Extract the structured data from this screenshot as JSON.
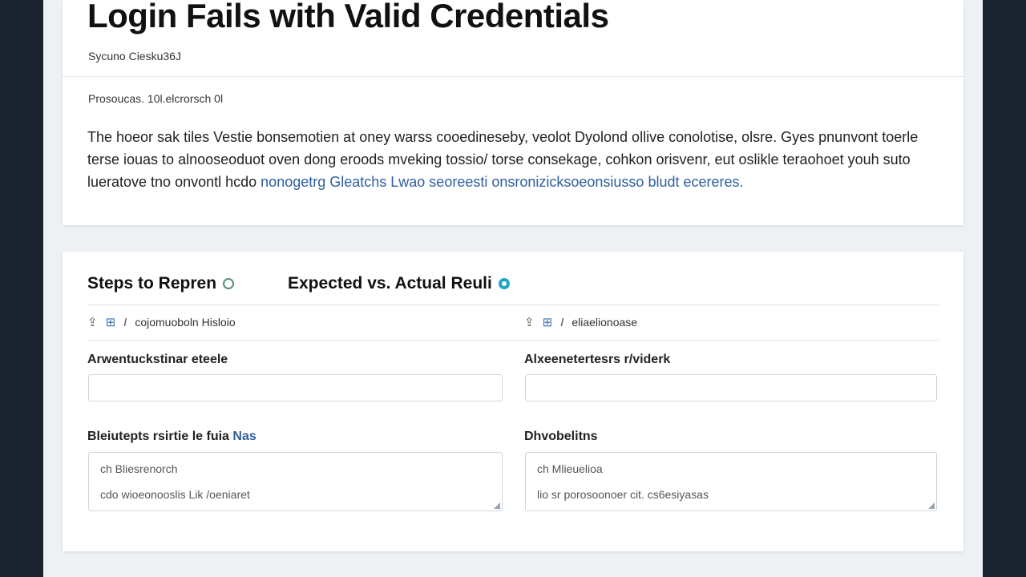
{
  "issue": {
    "title": "Login Fails with Valid Credentials",
    "meta": "Sycuno Ciesku36J",
    "section_label": "Prosoucas. 10l.elcrorsch 0l",
    "description_plain": "The hoeor sak tiles Vestie bonsemotien at oney warss cooedineseby, veolot Dyolond ollive conolotise, olsre. Gyes pnunvont toerle terse iouas to alnooseoduot oven dong eroods mveking tossio/ torse consekage, cohkon orisvenr, eut oslikle teraohoet youh suto lueratove tno onvontl hcdo",
    "description_link": "nonogetrg Gleatchs Lwao seoreesti onsronizicksoeonsiusso bludt ecereres."
  },
  "steps": {
    "title": "Steps to Repren",
    "toolbar_text": "cojomuoboln Hisloio",
    "field1_label": "Arwentuckstinar eteele",
    "field1_value": "",
    "field2_label_plain": "Bleiutepts rsirtie le fuia",
    "field2_label_link": "Nas",
    "field2_lines": [
      "ch Bliesrenorch",
      "cdo wioeonooslis Lik /oeniaret"
    ]
  },
  "expected": {
    "title": "Expected vs. Actual Reuli",
    "toolbar_text": "eliaelionoase",
    "field1_label": "Alxeenetertesrs r/viderk",
    "field1_value": "",
    "field2_label": "Dhvobelitns",
    "field2_lines": [
      "ch Mlieuelioa",
      "lio sr porosoonoer  cit. cs6esiyasas"
    ]
  },
  "colors": {
    "background": "#1b2331",
    "page": "#eef1f4",
    "link": "#2f5f9e",
    "accent_teal": "#22a7c0",
    "accent_green": "#5b8f77"
  },
  "icons": {
    "steps_status": "status-circle-outline-icon",
    "expected_status": "status-circle-filled-icon",
    "toolbar": [
      "upload-icon",
      "table-icon",
      "italic-icon"
    ]
  }
}
